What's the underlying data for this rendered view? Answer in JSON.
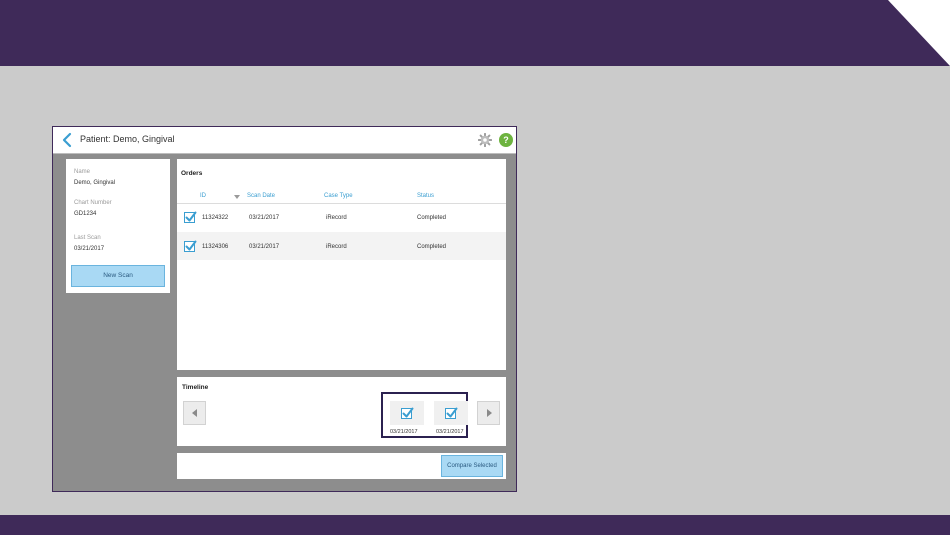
{
  "header": {
    "patient_title": "Patient: Demo, Gingival"
  },
  "patient_info": {
    "name_label": "Name",
    "name_value": "Demo, Gingival",
    "chart_label": "Chart Number",
    "chart_value": "GD1234",
    "last_scan_label": "Last Scan",
    "last_scan_value": "03/21/2017",
    "new_scan_label": "New Scan"
  },
  "orders": {
    "title": "Orders",
    "columns": {
      "id": "ID",
      "scan_date": "Scan Date",
      "case_type": "Case Type",
      "status": "Status"
    },
    "rows": [
      {
        "id": "11324322",
        "scan_date": "03/21/2017",
        "case_type": "iRecord",
        "status": "Completed",
        "checked": true
      },
      {
        "id": "11324306",
        "scan_date": "03/21/2017",
        "case_type": "iRecord",
        "status": "Completed",
        "checked": true
      }
    ]
  },
  "timeline": {
    "title": "Timeline",
    "items": [
      {
        "date": "03/21/2017",
        "checked": true
      },
      {
        "date": "03/21/2017",
        "checked": true
      }
    ]
  },
  "actions": {
    "compare_label": "Compare Selected"
  },
  "icons": {
    "back": "chevron-left-icon",
    "settings": "gear-icon",
    "help": "help-icon",
    "help_glyph": "?",
    "sort": "sort-down-icon",
    "timeline_prev": "arrow-left-icon",
    "timeline_next": "arrow-right-icon"
  },
  "colors": {
    "brand_purple": "#3f2a59",
    "accent_blue": "#3a9ed1",
    "button_blue": "#a9d9f4",
    "help_green": "#6db33f",
    "background_gray": "#cbcbcb",
    "app_gray": "#8d8d8d"
  }
}
